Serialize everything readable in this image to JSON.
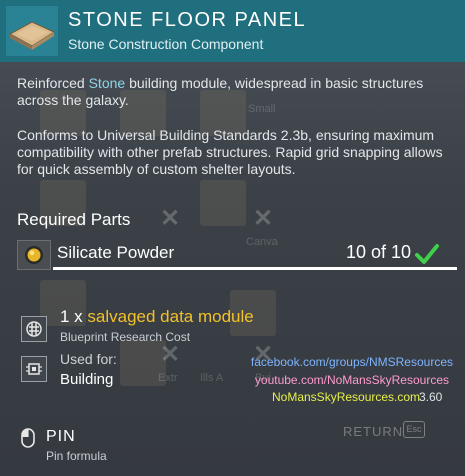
{
  "header": {
    "title": "STONE FLOOR PANEL",
    "subtitle": "Stone Construction Component"
  },
  "description": {
    "para1_before": "Reinforced ",
    "para1_highlight": "Stone",
    "para1_after": " building module, widespread in basic structures across the galaxy.",
    "para2": "Conforms to Universal Building Standards 2.3b, ensuring maximum compatibility with other prefab structures. Rapid grid snapping allows for quick assembly of custom shelter layouts."
  },
  "required_parts": {
    "title": "Required Parts",
    "items": [
      {
        "name": "Silicate Powder",
        "count": "10 of 10",
        "icon": "silicate-powder-icon",
        "satisfied": true
      }
    ]
  },
  "blueprint": {
    "amount": "1 x ",
    "item": "salvaged data module",
    "caption": "Blueprint Research Cost",
    "icon": "blueprint-icon"
  },
  "used_for": {
    "label": "Used for:",
    "value": "Building",
    "icon": "building-chip-icon"
  },
  "watermark": {
    "facebook": "facebook.com/groups/NMSResources",
    "youtube": "youtube.com/NoMansSkyResources",
    "site": "NoMansSkyResources.com",
    "version": "3.60"
  },
  "pin": {
    "label": "PIN",
    "caption": "Pin formula"
  },
  "return": {
    "label": "RETURN",
    "key": "Esc"
  },
  "background": {
    "labels": [
      "Small",
      "Canva",
      "Extr",
      "Ills A",
      "Bui"
    ]
  },
  "colors": {
    "header_bg": "#1f6f7e",
    "highlight": "#8fd3e8",
    "item_gold": "#f3c02a",
    "check_green": "#3fcf4a"
  }
}
